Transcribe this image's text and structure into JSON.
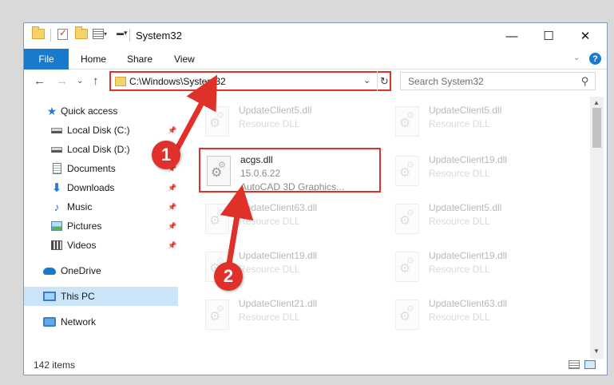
{
  "window": {
    "title": "System32",
    "controls": {
      "minimize": "—",
      "maximize": "☐",
      "close": "✕"
    }
  },
  "ribbon": {
    "file": "File",
    "tabs": [
      "Home",
      "Share",
      "View"
    ],
    "help": "?"
  },
  "address": {
    "path": "C:\\Windows\\System32",
    "search_placeholder": "Search System32"
  },
  "nav": {
    "items": [
      {
        "label": "Quick access",
        "icon": "star-icon"
      },
      {
        "label": "Local Disk (C:)",
        "icon": "drive-icon",
        "pinned": true
      },
      {
        "label": "Local Disk (D:)",
        "icon": "drive-icon",
        "pinned": true
      },
      {
        "label": "Documents",
        "icon": "documents-icon",
        "pinned": true
      },
      {
        "label": "Downloads",
        "icon": "download-icon",
        "pinned": true
      },
      {
        "label": "Music",
        "icon": "music-icon",
        "pinned": true
      },
      {
        "label": "Pictures",
        "icon": "pictures-icon",
        "pinned": true
      },
      {
        "label": "Videos",
        "icon": "videos-icon",
        "pinned": true
      },
      {
        "label": "OneDrive",
        "icon": "onedrive-icon"
      },
      {
        "label": "This PC",
        "icon": "computer-icon",
        "selected": true
      },
      {
        "label": "Network",
        "icon": "network-icon"
      }
    ]
  },
  "files": {
    "left": [
      {
        "name": "UpdateClient5.dll",
        "meta1": "Resource DLL",
        "meta2": ""
      },
      {
        "name": "acgs.dll",
        "meta1": "15.0.6.22",
        "meta2": "AutoCAD 3D Graphics..."
      },
      {
        "name": "UpdateClient63.dll",
        "meta1": "Resource DLL",
        "meta2": ""
      },
      {
        "name": "UpdateClient19.dll",
        "meta1": "Resource DLL",
        "meta2": ""
      },
      {
        "name": "UpdateClient21.dll",
        "meta1": "Resource DLL",
        "meta2": ""
      }
    ],
    "right": [
      {
        "name": "UpdateClient5.dll",
        "meta1": "Resource DLL"
      },
      {
        "name": "UpdateClient19.dll",
        "meta1": "Resource DLL"
      },
      {
        "name": "UpdateClient5.dll",
        "meta1": "Resource DLL"
      },
      {
        "name": "UpdateClient19.dll",
        "meta1": "Resource DLL"
      },
      {
        "name": "UpdateClient63.dll",
        "meta1": "Resource DLL"
      }
    ]
  },
  "status": {
    "count": "142 items"
  },
  "annotations": {
    "step1": "1",
    "step2": "2"
  },
  "colors": {
    "accent": "#1979ca",
    "annotation_red": "#e0302a",
    "selection": "#cce4f7"
  }
}
